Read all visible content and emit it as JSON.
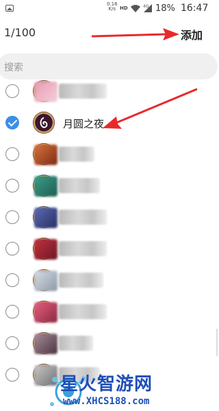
{
  "status_bar": {
    "speed": "0.16\nK/s",
    "hd": "HD",
    "battery": "18%",
    "time": "16:47"
  },
  "header": {
    "count": "1/100",
    "add_label": "添加"
  },
  "search": {
    "placeholder": "搜索"
  },
  "contacts": [
    {
      "name": "",
      "selected": false,
      "redacted": true
    },
    {
      "name": "月圆之夜",
      "selected": true,
      "redacted": false
    },
    {
      "name": "",
      "selected": false,
      "redacted": true
    },
    {
      "name": "",
      "selected": false,
      "redacted": true
    },
    {
      "name": "",
      "selected": false,
      "redacted": true
    },
    {
      "name": "",
      "selected": false,
      "redacted": true
    },
    {
      "name": "",
      "selected": false,
      "redacted": true
    },
    {
      "name": "",
      "selected": false,
      "redacted": true
    },
    {
      "name": "",
      "selected": false,
      "redacted": true
    },
    {
      "name": "",
      "selected": false,
      "redacted": true
    }
  ],
  "watermark": {
    "title": "星火智游网",
    "url": "www.XHCS188.com"
  },
  "colors": {
    "accent_check": "#3b8fe8",
    "arrow": "#e8292c",
    "watermark": "#1f4fb8"
  }
}
